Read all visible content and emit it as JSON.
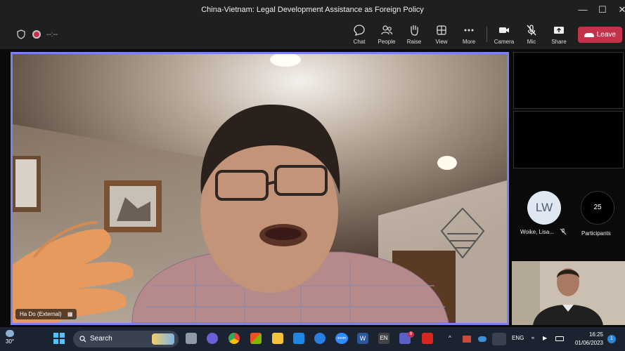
{
  "window": {
    "title": "China-Vietnam: Legal Development Assistance as Foreign Policy",
    "minimize_icon": "minimize-icon",
    "maximize_icon": "maximize-icon",
    "close_icon": "close-icon"
  },
  "meeting_bar": {
    "timer": "--:--",
    "buttons": {
      "chat": "Chat",
      "people": "People",
      "raise": "Raise",
      "view": "View",
      "more": "More",
      "camera": "Camera",
      "mic": "Mic",
      "share": "Share"
    },
    "leave": "Leave",
    "leave_color": "#c4314b"
  },
  "stage": {
    "speaker_name": "Ha Do (External)",
    "border_color": "#7b83eb"
  },
  "roster": {
    "avatar_initials": "LW",
    "avatar_name": "Woike, Lisa...",
    "participant_count": "25",
    "participants_label": "Participants"
  },
  "taskbar": {
    "temperature": "30°",
    "search_label": "Search",
    "teams_badge": "8",
    "zoom_label": "zoom",
    "en_label": "EN",
    "language": "ENG",
    "time": "16:25",
    "date": "01/06/2023",
    "notifications": "1"
  }
}
